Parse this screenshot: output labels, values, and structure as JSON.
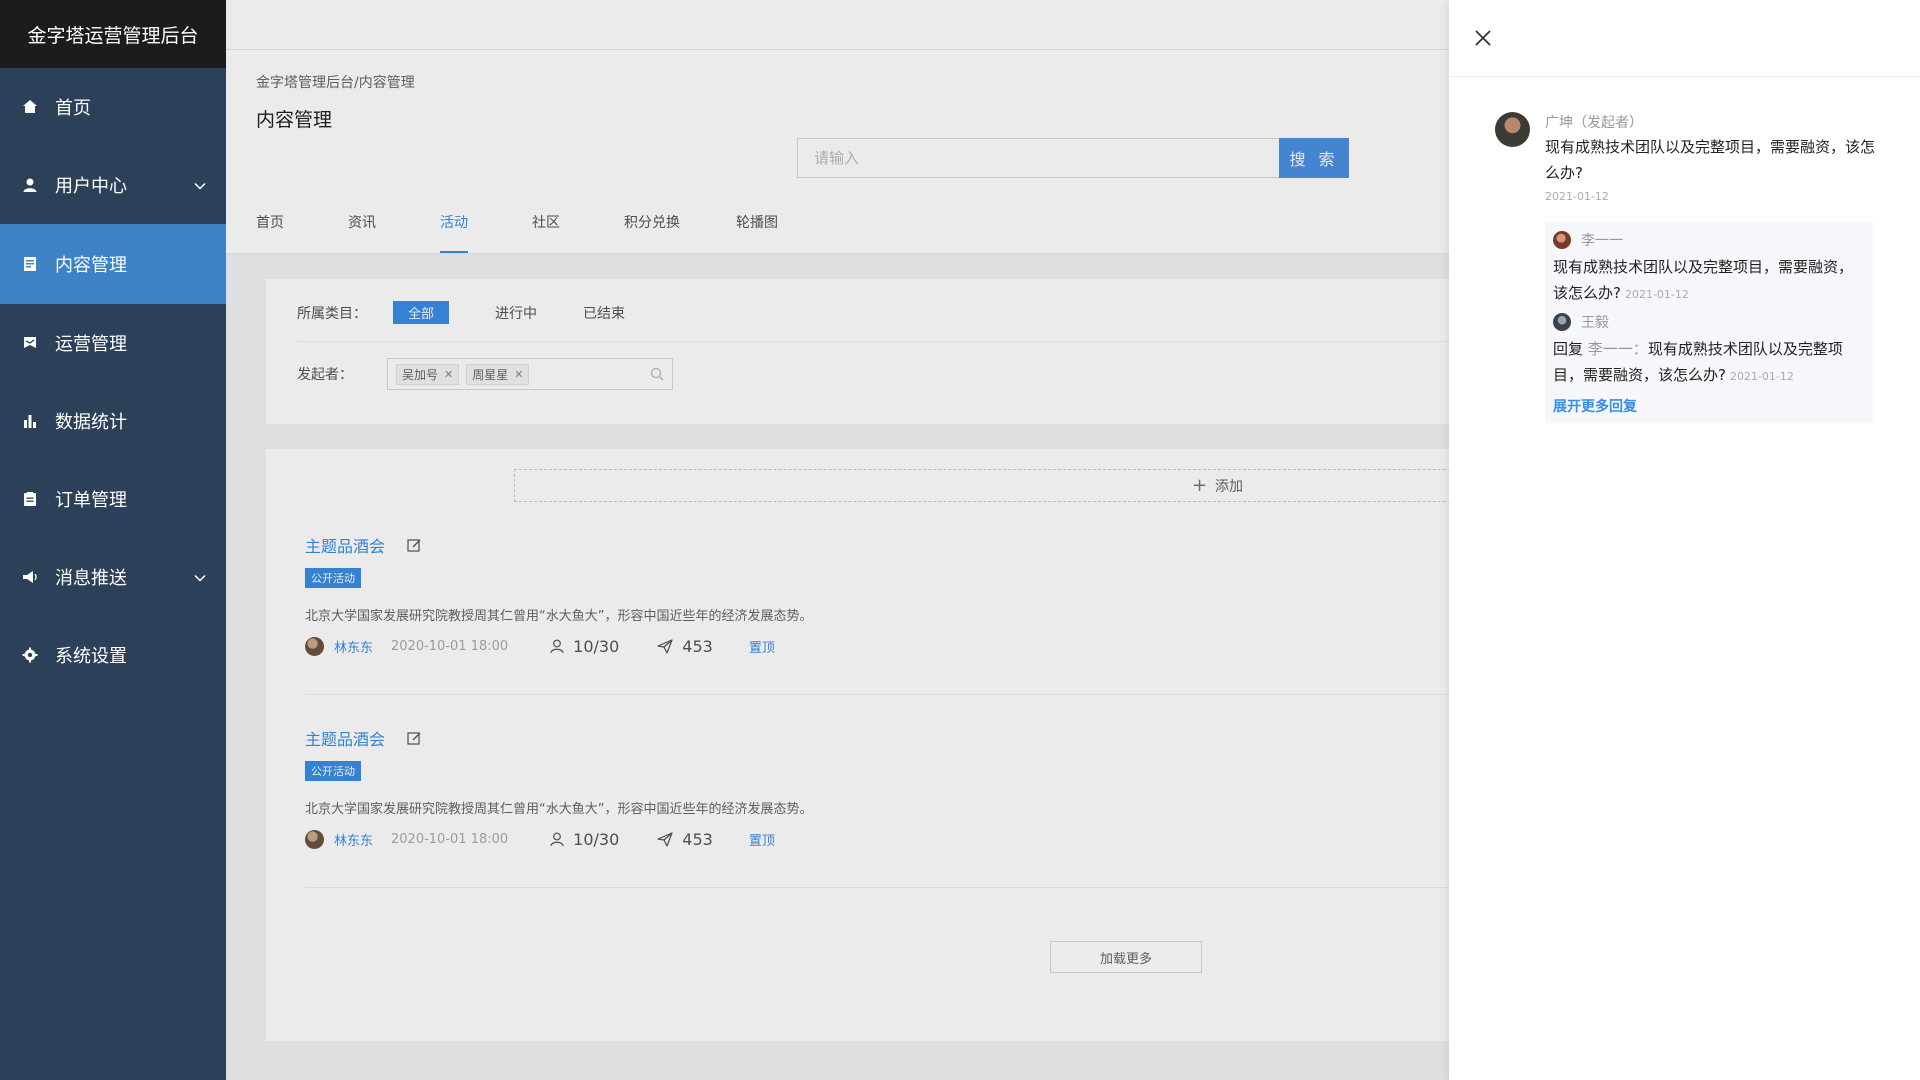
{
  "sidebar": {
    "logo": "金字塔运营管理后台",
    "items": [
      {
        "label": "首页"
      },
      {
        "label": "用户中心"
      },
      {
        "label": "内容管理"
      },
      {
        "label": "运营管理"
      },
      {
        "label": "数据统计"
      },
      {
        "label": "订单管理"
      },
      {
        "label": "消息推送"
      },
      {
        "label": "系统设置"
      }
    ]
  },
  "header": {
    "breadcrumb": "金字塔管理后台/内容管理",
    "title": "内容管理"
  },
  "search": {
    "placeholder": "请输入",
    "button": "搜 索"
  },
  "tabs": [
    "首页",
    "资讯",
    "活动",
    "社区",
    "积分兑换",
    "轮播图"
  ],
  "filter": {
    "category_label": "所属类目：",
    "options": [
      "全部",
      "进行中",
      "已结束"
    ],
    "initiator_label": "发起者：",
    "tags": [
      "吴加号",
      "周星星"
    ]
  },
  "list": {
    "add_label": "添加",
    "load_more": "加载更多",
    "activities": [
      {
        "title": "主题品酒会",
        "badge": "公开活动",
        "desc": "北京大学国家发展研究院教授周其仁曾用“水大鱼大”，形容中国近些年的经济发展态势。",
        "author": "林东东",
        "date": "2020-10-01 18:00",
        "participants": "10/30",
        "shares": "453",
        "pin": "置顶"
      },
      {
        "title": "主题品酒会",
        "badge": "公开活动",
        "desc": "北京大学国家发展研究院教授周其仁曾用“水大鱼大”，形容中国近些年的经济发展态势。",
        "author": "林东东",
        "date": "2020-10-01 18:00",
        "participants": "10/30",
        "shares": "453",
        "pin": "置顶"
      }
    ]
  },
  "drawer": {
    "comment": {
      "author": "广坤（发起者）",
      "text": "现有成熟技术团队以及完整项目，需要融资，该怎么办?",
      "date": "2021-01-12"
    },
    "replies": [
      {
        "author": "李一一",
        "text": "现有成熟技术团队以及完整项目，需要融资，该怎么办?",
        "date": "2021-01-12"
      },
      {
        "author": "王毅",
        "reply_prefix": "回复",
        "reply_to": "李一一：",
        "text": "现有成熟技术团队以及完整项目，需要融资，该怎么办?",
        "date": "2021-01-12"
      }
    ],
    "expand_more": "展开更多回复"
  },
  "colors": {
    "sidebar_bg": "#2d4059",
    "sidebar_active": "#3d82c7",
    "accent": "#3a8ee6"
  }
}
